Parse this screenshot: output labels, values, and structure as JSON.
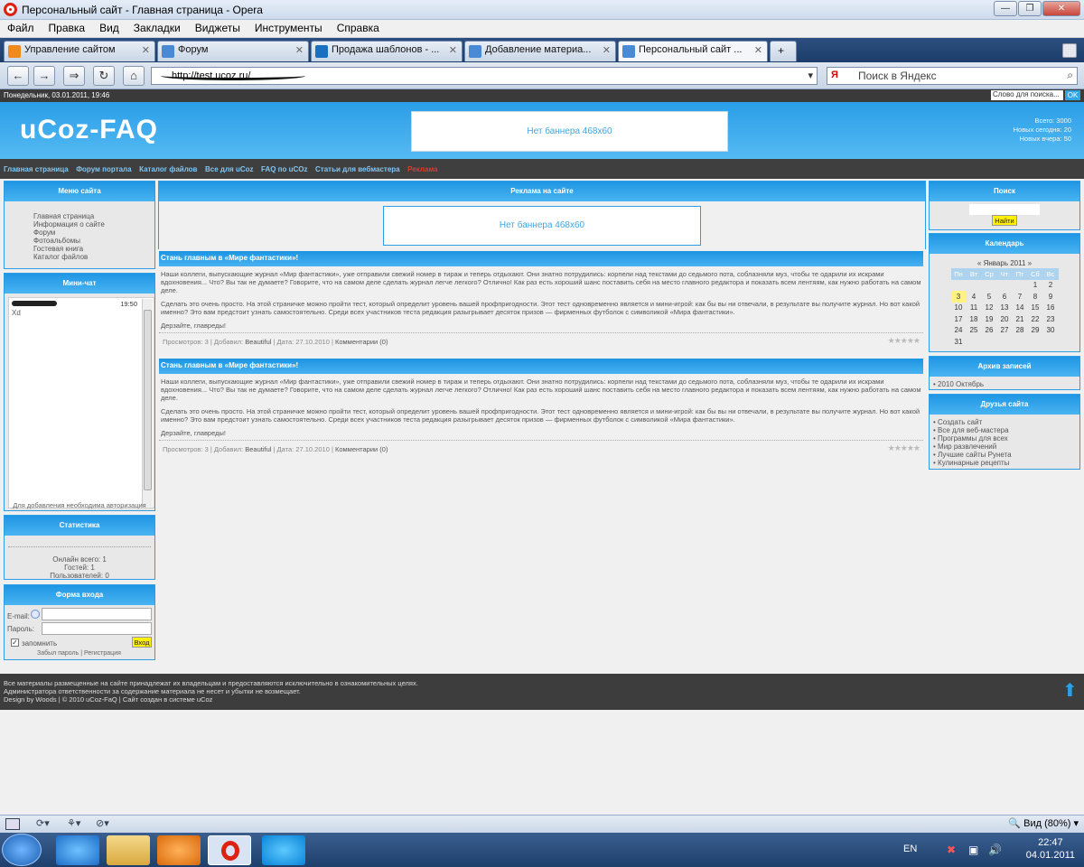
{
  "window": {
    "title": "Персональный сайт - Главная страница - Opera",
    "controls": [
      "—",
      "❐",
      "✕"
    ]
  },
  "menu": [
    "Файл",
    "Правка",
    "Вид",
    "Закладки",
    "Виджеты",
    "Инструменты",
    "Справка"
  ],
  "tabs": [
    {
      "label": "Управление сайтом",
      "color": "#f08a1c"
    },
    {
      "label": "Форум",
      "color": "#4a8ad4"
    },
    {
      "label": "Продажа шаблонов - ...",
      "color": "#1a6fc0"
    },
    {
      "label": "Добавление материа...",
      "color": "#4a8ad4"
    },
    {
      "label": "Персональный сайт ...",
      "color": "#4a8ad4"
    }
  ],
  "address": {
    "value": "http://test.ucoz.ru/"
  },
  "search": {
    "placeholder": "Поиск в Яндекс",
    "engine": "Я"
  },
  "page": {
    "date": "Понедельник, 03.01.2011, 19:46",
    "top_search_placeholder": "Слово для поиска...",
    "top_search_ok": "OK",
    "logo": "uCoz-FAQ",
    "banner": "Нет баннера 468x60",
    "stats_top": [
      "Всего: 3000",
      "Новых сегодня: 20",
      "Новых вчера: 50"
    ],
    "nav": [
      "Главная страница",
      "Форум портала",
      "Каталог файлов",
      "Все для uCoz",
      "FAQ по uCOz",
      "Статьи для вебмастера",
      "Реклама"
    ]
  },
  "left": {
    "menu_title": "Меню сайта",
    "menu_items": [
      "Главная страница",
      "Информация о сайте",
      "Форум",
      "Фотоальбомы",
      "Гостевая книга",
      "Каталог файлов"
    ],
    "chat_title": "Мини-чат",
    "chat_time": "19:50",
    "chat_msg": "Xd",
    "chat_note": "Для добавления необходима авторизация",
    "stats_title": "Статистика",
    "stats": [
      "Онлайн всего: 1",
      "Гостей: 1",
      "Пользователей: 0"
    ],
    "login_title": "Форма входа",
    "email_label": "E-mail:",
    "password_label": "Пароль:",
    "remember": "запомнить",
    "login_btn": "Вход",
    "forgot": "Забыл пароль",
    "register": "Регистрация"
  },
  "middle": {
    "ads_title": "Реклама на сайте",
    "banner": "Нет баннера 468x60",
    "post_title": "Стань главным в «Мире фантастики»!",
    "p1": "Наши коллеги, выпускающие журнал «Мир фантастики», уже отправили свежий номер в тираж и теперь отдыхают. Они знатно потрудились: корпели над текстами до седьмого пота, соблазняли муз, чтобы те одарили их искрами вдохновения... Что? Вы так не думаете? Говорите, что на самом деле сделать журнал легче легкого? Отлично! Как раз есть хороший шанс поставить себя на место главного редактора и показать всем лентяям, как нужно работать на самом деле.",
    "p2": "Сделать это очень просто. На этой страничке можно пройти тест, который определит уровень вашей профпригодности. Этот тест одновременно является и мини-игрой: как бы вы ни отвечали, в результате вы получите журнал. Но вот какой именно? Это вам предстоит узнать самостоятельно. Среди всех участников теста редакция разыгрывает десяток призов — фирменных футболок с символикой «Мира фантастики».",
    "p3": "Дерзайте, главреды!",
    "meta_views": "Просмотров: 3",
    "meta_added": "Добавил:",
    "meta_author": "Beautiful",
    "meta_date": "Дата: 27.10.2010",
    "meta_comments": "Комментарии (0)",
    "stars": "★★★★★"
  },
  "right": {
    "search_title": "Поиск",
    "search_btn": "Найти",
    "calendar_title": "Календарь",
    "calendar_month": "« Январь 2011 »",
    "weekdays": [
      "Пн",
      "Вт",
      "Ср",
      "Чт",
      "Пт",
      "Сб",
      "Вс"
    ],
    "weeks": [
      [
        "",
        "",
        "",
        "",
        "",
        "1",
        "2"
      ],
      [
        "3",
        "4",
        "5",
        "6",
        "7",
        "8",
        "9"
      ],
      [
        "10",
        "11",
        "12",
        "13",
        "14",
        "15",
        "16"
      ],
      [
        "17",
        "18",
        "19",
        "20",
        "21",
        "22",
        "23"
      ],
      [
        "24",
        "25",
        "26",
        "27",
        "28",
        "29",
        "30"
      ],
      [
        "31",
        "",
        "",
        "",
        "",
        "",
        ""
      ]
    ],
    "archive_title": "Архив записей",
    "archive_item": "2010 Октябрь",
    "friends_title": "Друзья сайта",
    "friends": [
      "Создать сайт",
      "Все для веб-мастера",
      "Программы для всех",
      "Мир развлечений",
      "Лучшие сайты Рунета",
      "Кулинарные рецепты"
    ]
  },
  "footer": {
    "lines": [
      "Все материалы размещенные на сайте принадлежат их владельцам и предоставляются исключительно в ознакомительных целях.",
      "Администратора ответственности за содержание материала не несет и убытки не возмещает.",
      "Design by Woods | © 2010 uCoz-FaQ | Сайт создан в системе uCoz"
    ]
  },
  "status": {
    "zoom": "Вид (80%)"
  },
  "taskbar": {
    "lang": "EN",
    "time": "22:47",
    "date": "04.01.2011"
  }
}
